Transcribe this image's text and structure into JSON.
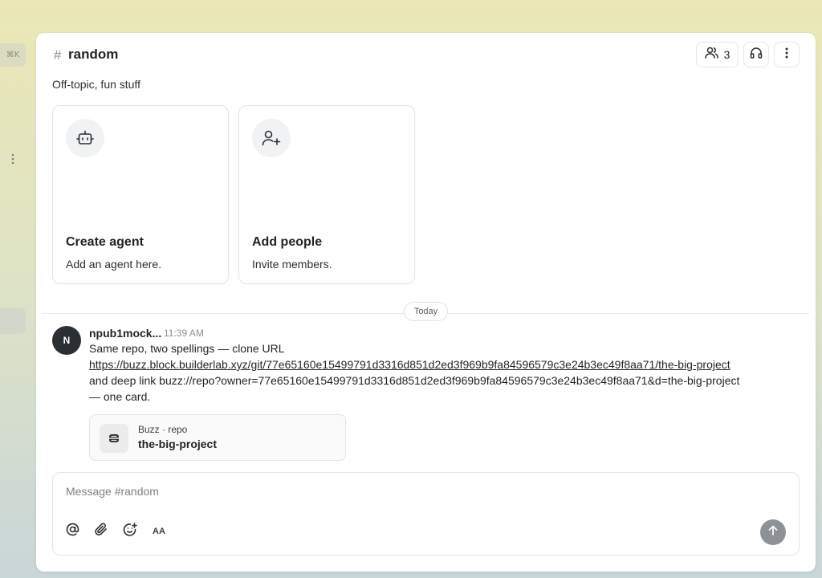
{
  "sidebar": {
    "shortcut_hint": "⌘K"
  },
  "header": {
    "channel_hash": "#",
    "channel_name": "random",
    "member_count": "3"
  },
  "channel": {
    "description": "Off-topic, fun stuff"
  },
  "cards": [
    {
      "title": "Create agent",
      "subtitle": "Add an agent here.",
      "icon": "bot-icon"
    },
    {
      "title": "Add people",
      "subtitle": "Invite members.",
      "icon": "user-plus-icon"
    }
  ],
  "day_separator": "Today",
  "message": {
    "avatar_initial": "N",
    "author": "npub1mock...",
    "time": "11:39 AM",
    "line1": "Same repo, two spellings — clone URL",
    "link": "https://buzz.block.builderlab.xyz/git/77e65160e15499791d3316d851d2ed3f969b9fa84596579c3e24b3ec49f8aa71/the-big-project",
    "line3": "and deep link buzz://repo?owner=77e65160e15499791d3316d851d2ed3f969b9fa84596579c3e24b3ec49f8aa71&d=the-big-project",
    "line4": "— one card.",
    "repo_card": {
      "kind": "Buzz · repo",
      "name": "the-big-project"
    }
  },
  "composer": {
    "placeholder": "Message #random",
    "format_label": "AA"
  },
  "colors": {
    "accent_dark": "#2b2f33",
    "send_button": "#8d9196",
    "border": "#e3e4e6"
  }
}
